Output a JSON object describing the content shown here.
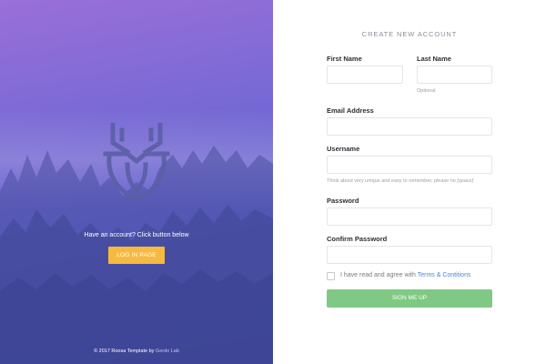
{
  "left_panel": {
    "have_account_text": "Have an account? Click button below",
    "login_button_label": "LOG IN PAGE",
    "copyright_prefix": "© 2017 Roosa Template by",
    "copyright_brand": "Gerdo Lab",
    "logo_icon": "deer-antler-shield-icon"
  },
  "form": {
    "title": "CREATE NEW ACCOUNT",
    "first_name": {
      "label": "First Name",
      "value": ""
    },
    "last_name": {
      "label": "Last Name",
      "value": "",
      "hint": "Optional"
    },
    "email": {
      "label": "Email Address",
      "value": ""
    },
    "username": {
      "label": "Username",
      "value": "",
      "hint_prefix": "Think about very unique and easy to remember, please no ",
      "hint_emphasis": "[space]"
    },
    "password": {
      "label": "Password",
      "value": ""
    },
    "confirm_password": {
      "label": "Confirm Password",
      "value": ""
    },
    "agree_text": "I have read and agree with",
    "terms_link": "Terms & Contitions",
    "submit_label": "SIGN ME UP"
  },
  "colors": {
    "gradient_top": "#9a6fd8",
    "gradient_bottom": "#4b56b4",
    "login_button": "#f7b93e",
    "signup_button": "#80c984",
    "link": "#4e86d6"
  }
}
